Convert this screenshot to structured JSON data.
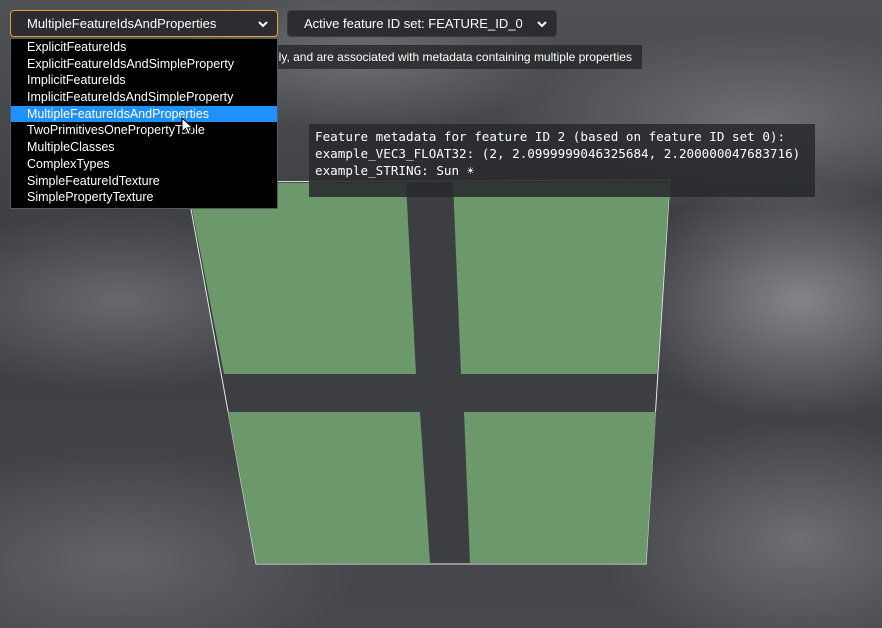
{
  "model_select": {
    "selected": "MultipleFeatureIdsAndProperties",
    "options": [
      "ExplicitFeatureIds",
      "ExplicitFeatureIdsAndSimpleProperty",
      "ImplicitFeatureIds",
      "ImplicitFeatureIdsAndSimpleProperty",
      "MultipleFeatureIdsAndProperties",
      "TwoPrimitivesOnePropertyTable",
      "MultipleClasses",
      "ComplexTypes",
      "SimpleFeatureIdTexture",
      "SimplePropertyTexture"
    ],
    "highlighted_index": 4
  },
  "feature_id_select": {
    "label": "Active feature ID set: FEATURE_ID_0"
  },
  "description": "ely, and are associated with metadata containing multiple properties",
  "tooltip": {
    "line1": "Feature metadata for feature ID 2 (based on feature ID set 0):",
    "line2": "example_VEC3_FLOAT32: (2, 2.0999999046325684, 2.200000047683716)",
    "line3": "example_STRING: Sun ☀"
  },
  "colors": {
    "accent_border": "#e0a33a",
    "highlight": "#1e90ff",
    "model_green": "#6b996b"
  }
}
